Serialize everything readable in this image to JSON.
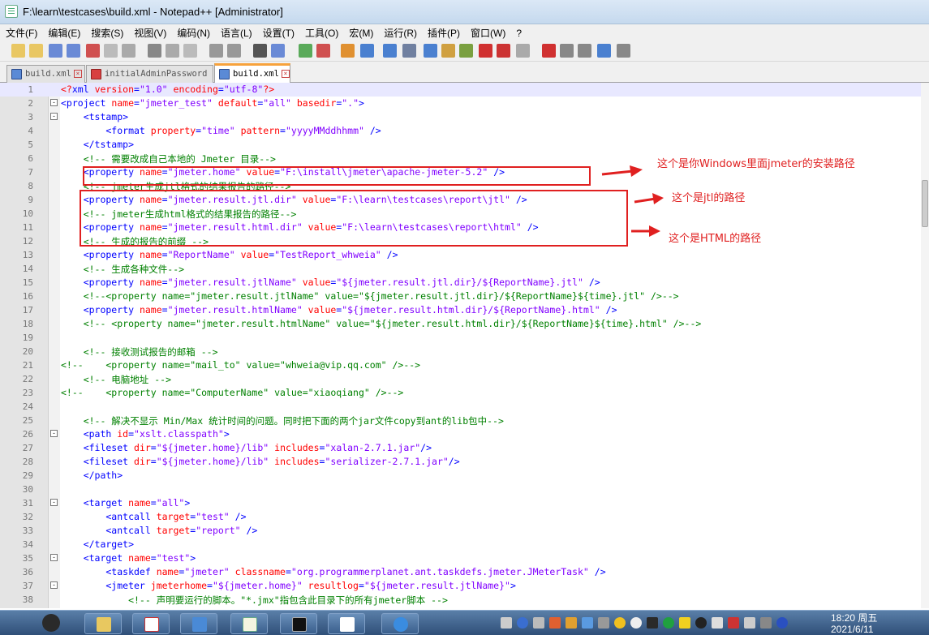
{
  "window": {
    "title": "F:\\learn\\testcases\\build.xml - Notepad++ [Administrator]"
  },
  "menu": [
    "文件(F)",
    "编辑(E)",
    "搜索(S)",
    "视图(V)",
    "编码(N)",
    "语言(L)",
    "设置(T)",
    "工具(O)",
    "宏(M)",
    "运行(R)",
    "插件(P)",
    "窗口(W)",
    "?"
  ],
  "tabs": [
    {
      "label": "build.xml",
      "active": false,
      "icon": "save-icon-blue"
    },
    {
      "label": "initialAdminPassword",
      "active": false,
      "icon": "save-icon-red"
    },
    {
      "label": "build.xml",
      "active": true,
      "icon": "save-icon-blue"
    }
  ],
  "annotations": {
    "home": "这个是你Windows里面jmeter的安装路径",
    "jtl": "这个是jtl的路径",
    "html": "这个是HTML的路径"
  },
  "lines": [
    {
      "n": "1",
      "fold": "",
      "segs": [
        [
          "pi",
          "<?"
        ],
        [
          "tg",
          "xml "
        ],
        [
          "at",
          "version"
        ],
        [
          "tg",
          "="
        ],
        [
          "vl",
          "\"1.0\" "
        ],
        [
          "at",
          "encoding"
        ],
        [
          "tg",
          "="
        ],
        [
          "vl",
          "\"utf-8\""
        ],
        [
          "pi",
          "?>"
        ]
      ]
    },
    {
      "n": "2",
      "fold": "-",
      "segs": [
        [
          "tg",
          "<project "
        ],
        [
          "at",
          "name"
        ],
        [
          "tg",
          "="
        ],
        [
          "vl",
          "\"jmeter_test\" "
        ],
        [
          "at",
          "default"
        ],
        [
          "tg",
          "="
        ],
        [
          "vl",
          "\"all\" "
        ],
        [
          "at",
          "basedir"
        ],
        [
          "tg",
          "="
        ],
        [
          "vl",
          "\".\""
        ],
        [
          "tg",
          ">"
        ]
      ]
    },
    {
      "n": "3",
      "fold": "-",
      "segs": [
        [
          "tg",
          "    <tstamp>"
        ]
      ]
    },
    {
      "n": "4",
      "fold": "",
      "segs": [
        [
          "tg",
          "        <format "
        ],
        [
          "at",
          "property"
        ],
        [
          "tg",
          "="
        ],
        [
          "vl",
          "\"time\" "
        ],
        [
          "at",
          "pattern"
        ],
        [
          "tg",
          "="
        ],
        [
          "vl",
          "\"yyyyMMddhhmm\" "
        ],
        [
          "tg",
          "/>"
        ]
      ]
    },
    {
      "n": "5",
      "fold": "",
      "segs": [
        [
          "tg",
          "    </tstamp>"
        ]
      ]
    },
    {
      "n": "6",
      "fold": "",
      "segs": [
        [
          "cm",
          "    <!-- 需要改成自己本地的 Jmeter 目录-->"
        ]
      ]
    },
    {
      "n": "7",
      "fold": "",
      "segs": [
        [
          "tg",
          "    <property "
        ],
        [
          "at",
          "name"
        ],
        [
          "tg",
          "="
        ],
        [
          "vl",
          "\"jmeter.home\" "
        ],
        [
          "at",
          "value"
        ],
        [
          "tg",
          "="
        ],
        [
          "vl",
          "\"F:\\install\\jmeter\\apache-jmeter-5.2\" "
        ],
        [
          "tg",
          "/>"
        ]
      ]
    },
    {
      "n": "8",
      "fold": "",
      "segs": [
        [
          "cm",
          "    <!-- jmeter生成jtl格式的结果报告的路径-->"
        ]
      ]
    },
    {
      "n": "9",
      "fold": "",
      "segs": [
        [
          "tg",
          "    <property "
        ],
        [
          "at",
          "name"
        ],
        [
          "tg",
          "="
        ],
        [
          "vl",
          "\"jmeter.result.jtl.dir\" "
        ],
        [
          "at",
          "value"
        ],
        [
          "tg",
          "="
        ],
        [
          "vl",
          "\"F:\\learn\\testcases\\report\\jtl\" "
        ],
        [
          "tg",
          "/>"
        ]
      ]
    },
    {
      "n": "10",
      "fold": "",
      "segs": [
        [
          "cm",
          "    <!-- jmeter生成html格式的结果报告的路径-->"
        ]
      ]
    },
    {
      "n": "11",
      "fold": "",
      "segs": [
        [
          "tg",
          "    <property "
        ],
        [
          "at",
          "name"
        ],
        [
          "tg",
          "="
        ],
        [
          "vl",
          "\"jmeter.result.html.dir\" "
        ],
        [
          "at",
          "value"
        ],
        [
          "tg",
          "="
        ],
        [
          "vl",
          "\"F:\\learn\\testcases\\report\\html\" "
        ],
        [
          "tg",
          "/>"
        ]
      ]
    },
    {
      "n": "12",
      "fold": "",
      "segs": [
        [
          "cm",
          "    <!-- 生成的报告的前缀 -->"
        ]
      ]
    },
    {
      "n": "13",
      "fold": "",
      "segs": [
        [
          "tg",
          "    <property "
        ],
        [
          "at",
          "name"
        ],
        [
          "tg",
          "="
        ],
        [
          "vl",
          "\"ReportName\" "
        ],
        [
          "at",
          "value"
        ],
        [
          "tg",
          "="
        ],
        [
          "vl",
          "\"TestReport_whweia\" "
        ],
        [
          "tg",
          "/>"
        ]
      ]
    },
    {
      "n": "14",
      "fold": "",
      "segs": [
        [
          "cm",
          "    <!-- 生成各种文件-->"
        ]
      ]
    },
    {
      "n": "15",
      "fold": "",
      "segs": [
        [
          "tg",
          "    <property "
        ],
        [
          "at",
          "name"
        ],
        [
          "tg",
          "="
        ],
        [
          "vl",
          "\"jmeter.result.jtlName\" "
        ],
        [
          "at",
          "value"
        ],
        [
          "tg",
          "="
        ],
        [
          "vl",
          "\"${jmeter.result.jtl.dir}/${ReportName}.jtl\" "
        ],
        [
          "tg",
          "/>"
        ]
      ]
    },
    {
      "n": "16",
      "fold": "",
      "segs": [
        [
          "cm",
          "    <!--<property name=\"jmeter.result.jtlName\" value=\"${jmeter.result.jtl.dir}/${ReportName}${time}.jtl\" />-->"
        ]
      ]
    },
    {
      "n": "17",
      "fold": "",
      "segs": [
        [
          "tg",
          "    <property "
        ],
        [
          "at",
          "name"
        ],
        [
          "tg",
          "="
        ],
        [
          "vl",
          "\"jmeter.result.htmlName\" "
        ],
        [
          "at",
          "value"
        ],
        [
          "tg",
          "="
        ],
        [
          "vl",
          "\"${jmeter.result.html.dir}/${ReportName}.html\" "
        ],
        [
          "tg",
          "/>"
        ]
      ]
    },
    {
      "n": "18",
      "fold": "",
      "segs": [
        [
          "cm",
          "    <!-- <property name=\"jmeter.result.htmlName\" value=\"${jmeter.result.html.dir}/${ReportName}${time}.html\" />-->"
        ]
      ]
    },
    {
      "n": "19",
      "fold": "",
      "segs": []
    },
    {
      "n": "20",
      "fold": "",
      "segs": [
        [
          "cm",
          "    <!-- 接收测试报告的邮箱 -->"
        ]
      ]
    },
    {
      "n": "21",
      "fold": "",
      "segs": [
        [
          "cm",
          "<!--    <property name=\"mail_to\" value=\"whweia@vip.qq.com\" />-->"
        ]
      ]
    },
    {
      "n": "22",
      "fold": "",
      "segs": [
        [
          "cm",
          "    <!-- 电脑地址 -->"
        ]
      ]
    },
    {
      "n": "23",
      "fold": "",
      "segs": [
        [
          "cm",
          "<!--    <property name=\"ComputerName\" value=\"xiaoqiang\" />-->"
        ]
      ]
    },
    {
      "n": "24",
      "fold": "",
      "segs": []
    },
    {
      "n": "25",
      "fold": "",
      "segs": [
        [
          "cm",
          "    <!-- 解决不显示 Min/Max 统计时间的问题。同时把下面的两个jar文件copy到ant的lib包中-->"
        ]
      ]
    },
    {
      "n": "26",
      "fold": "-",
      "segs": [
        [
          "tg",
          "    <path "
        ],
        [
          "at",
          "id"
        ],
        [
          "tg",
          "="
        ],
        [
          "vl",
          "\"xslt.classpath\""
        ],
        [
          "tg",
          ">"
        ]
      ]
    },
    {
      "n": "27",
      "fold": "",
      "segs": [
        [
          "tg",
          "    <fileset "
        ],
        [
          "at",
          "dir"
        ],
        [
          "tg",
          "="
        ],
        [
          "vl",
          "\"${jmeter.home}/lib\" "
        ],
        [
          "at",
          "includes"
        ],
        [
          "tg",
          "="
        ],
        [
          "vl",
          "\"xalan-2.7.1.jar\""
        ],
        [
          "tg",
          "/>"
        ]
      ]
    },
    {
      "n": "28",
      "fold": "",
      "segs": [
        [
          "tg",
          "    <fileset "
        ],
        [
          "at",
          "dir"
        ],
        [
          "tg",
          "="
        ],
        [
          "vl",
          "\"${jmeter.home}/lib\" "
        ],
        [
          "at",
          "includes"
        ],
        [
          "tg",
          "="
        ],
        [
          "vl",
          "\"serializer-2.7.1.jar\""
        ],
        [
          "tg",
          "/>"
        ]
      ]
    },
    {
      "n": "29",
      "fold": "",
      "segs": [
        [
          "tg",
          "    </path>"
        ]
      ]
    },
    {
      "n": "30",
      "fold": "",
      "segs": []
    },
    {
      "n": "31",
      "fold": "-",
      "segs": [
        [
          "tg",
          "    <target "
        ],
        [
          "at",
          "name"
        ],
        [
          "tg",
          "="
        ],
        [
          "vl",
          "\"all\""
        ],
        [
          "tg",
          ">"
        ]
      ]
    },
    {
      "n": "32",
      "fold": "",
      "segs": [
        [
          "tg",
          "        <antcall "
        ],
        [
          "at",
          "target"
        ],
        [
          "tg",
          "="
        ],
        [
          "vl",
          "\"test\" "
        ],
        [
          "tg",
          "/>"
        ]
      ]
    },
    {
      "n": "33",
      "fold": "",
      "segs": [
        [
          "tg",
          "        <antcall "
        ],
        [
          "at",
          "target"
        ],
        [
          "tg",
          "="
        ],
        [
          "vl",
          "\"report\" "
        ],
        [
          "tg",
          "/>"
        ]
      ]
    },
    {
      "n": "34",
      "fold": "",
      "segs": [
        [
          "tg",
          "    </target>"
        ]
      ]
    },
    {
      "n": "35",
      "fold": "-",
      "segs": [
        [
          "tg",
          "    <target "
        ],
        [
          "at",
          "name"
        ],
        [
          "tg",
          "="
        ],
        [
          "vl",
          "\"test\""
        ],
        [
          "tg",
          ">"
        ]
      ]
    },
    {
      "n": "36",
      "fold": "",
      "segs": [
        [
          "tg",
          "        <taskdef "
        ],
        [
          "at",
          "name"
        ],
        [
          "tg",
          "="
        ],
        [
          "vl",
          "\"jmeter\" "
        ],
        [
          "at",
          "classname"
        ],
        [
          "tg",
          "="
        ],
        [
          "vl",
          "\"org.programmerplanet.ant.taskdefs.jmeter.JMeterTask\" "
        ],
        [
          "tg",
          "/>"
        ]
      ]
    },
    {
      "n": "37",
      "fold": "-",
      "segs": [
        [
          "tg",
          "        <jmeter "
        ],
        [
          "at",
          "jmeterhome"
        ],
        [
          "tg",
          "="
        ],
        [
          "vl",
          "\"${jmeter.home}\" "
        ],
        [
          "at",
          "resultlog"
        ],
        [
          "tg",
          "="
        ],
        [
          "vl",
          "\"${jmeter.result.jtlName}\""
        ],
        [
          "tg",
          ">"
        ]
      ]
    },
    {
      "n": "38",
      "fold": "",
      "segs": [
        [
          "cm",
          "            <!-- 声明要运行的脚本。\"*.jmx\"指包含此目录下的所有jmeter脚本 -->"
        ]
      ]
    }
  ],
  "taskbar": {
    "time": "18:20 周五",
    "date": "2021/6/11"
  }
}
